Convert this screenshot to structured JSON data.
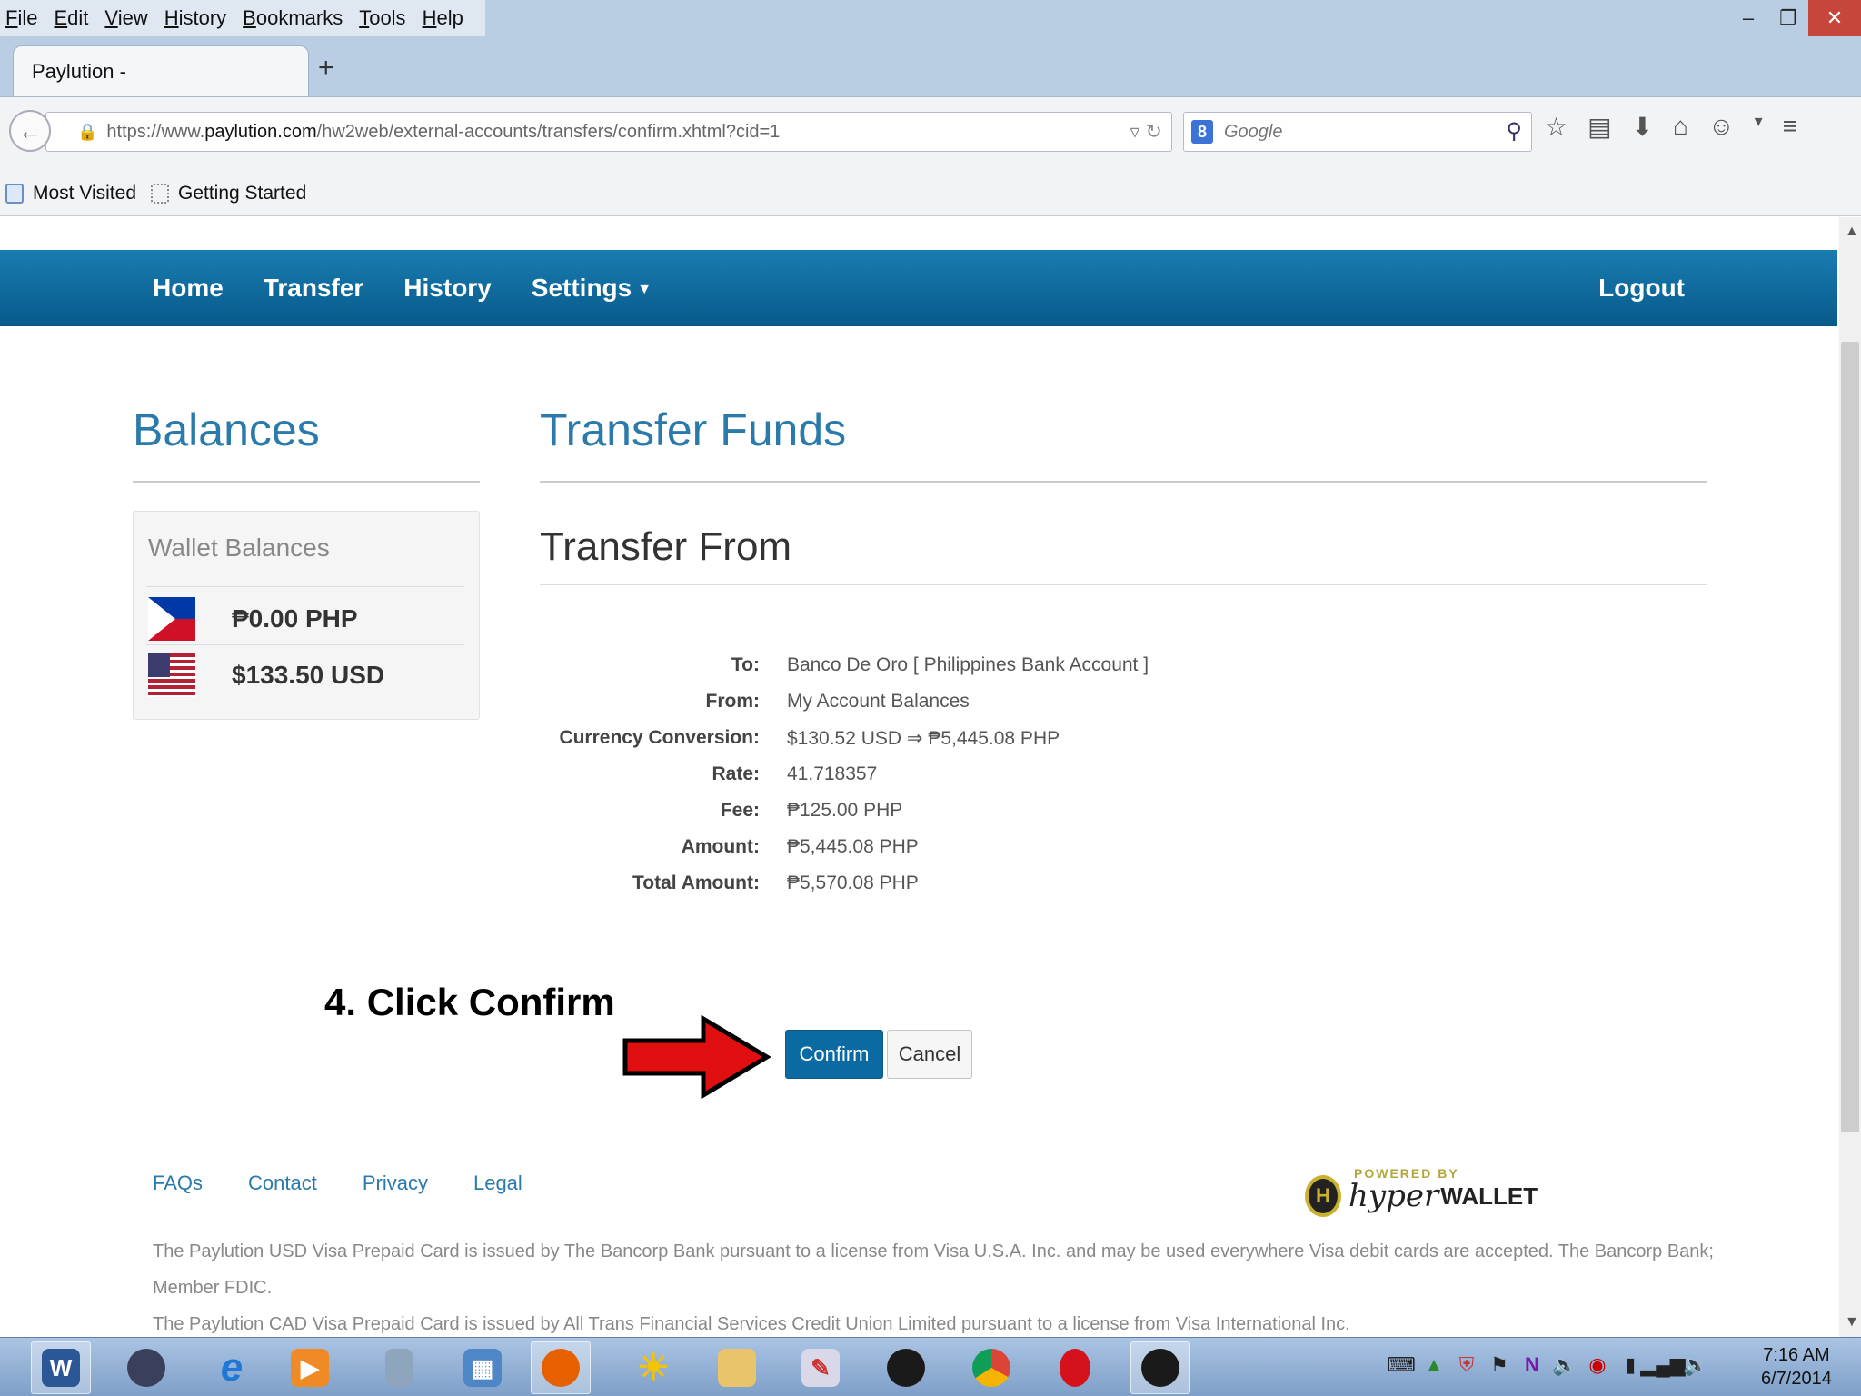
{
  "browser": {
    "menu": [
      "File",
      "Edit",
      "View",
      "History",
      "Bookmarks",
      "Tools",
      "Help"
    ],
    "tab_title": "Paylution -",
    "new_tab": "+",
    "url_prefix": "https://www.",
    "url_domain": "paylution.com",
    "url_path": "/hw2web/external-accounts/transfers/confirm.xhtml?cid=1",
    "search_placeholder": "Google",
    "bookmarks": [
      "Most Visited",
      "Getting Started"
    ]
  },
  "site_nav": {
    "links": [
      "Home",
      "Transfer",
      "History",
      "Settings"
    ],
    "logout": "Logout"
  },
  "balances": {
    "title": "Balances",
    "panel_heading": "Wallet Balances",
    "items": [
      {
        "flag": "philippines-flag",
        "amount": "₱0.00 PHP"
      },
      {
        "flag": "usa-flag",
        "amount": "$133.50 USD"
      }
    ]
  },
  "transfer": {
    "title": "Transfer Funds",
    "subtitle": "Transfer From",
    "details": [
      {
        "label": "To:",
        "value": "Banco De Oro [ Philippines Bank Account ]"
      },
      {
        "label": "From:",
        "value": "My Account Balances"
      },
      {
        "label": "Currency Conversion:",
        "value": "$130.52 USD ⇒ ₱5,445.08 PHP"
      },
      {
        "label": "Rate:",
        "value": "41.718357"
      },
      {
        "label": "Fee:",
        "value": "₱125.00 PHP"
      },
      {
        "label": "Amount:",
        "value": "₱5,445.08 PHP"
      },
      {
        "label": "Total Amount:",
        "value": "₱5,570.08 PHP"
      }
    ],
    "confirm_label": "Confirm",
    "cancel_label": "Cancel"
  },
  "annotation": "4. Click Confirm",
  "footer": {
    "links": [
      "FAQs",
      "Contact",
      "Privacy",
      "Legal"
    ],
    "powered_by": "POWERED BY",
    "logo_hyper": "hyper",
    "logo_wallet": "WALLET",
    "disclaimer_1": "The Paylution USD Visa Prepaid Card is issued by The Bancorp Bank pursuant to a license from Visa U.S.A. Inc. and may be used everywhere Visa debit cards are accepted. The Bancorp Bank; Member FDIC.",
    "disclaimer_2": "The Paylution CAD Visa Prepaid Card is issued by All Trans Financial Services Credit Union Limited pursuant to a license from Visa International Inc."
  },
  "taskbar": {
    "time": "7:16 AM",
    "date": "6/7/2014"
  },
  "colors": {
    "brand_blue": "#1a7cb1",
    "heading_blue": "#2a7bab",
    "confirm_button": "#0b6aa1",
    "arrow_red": "#e01010"
  }
}
